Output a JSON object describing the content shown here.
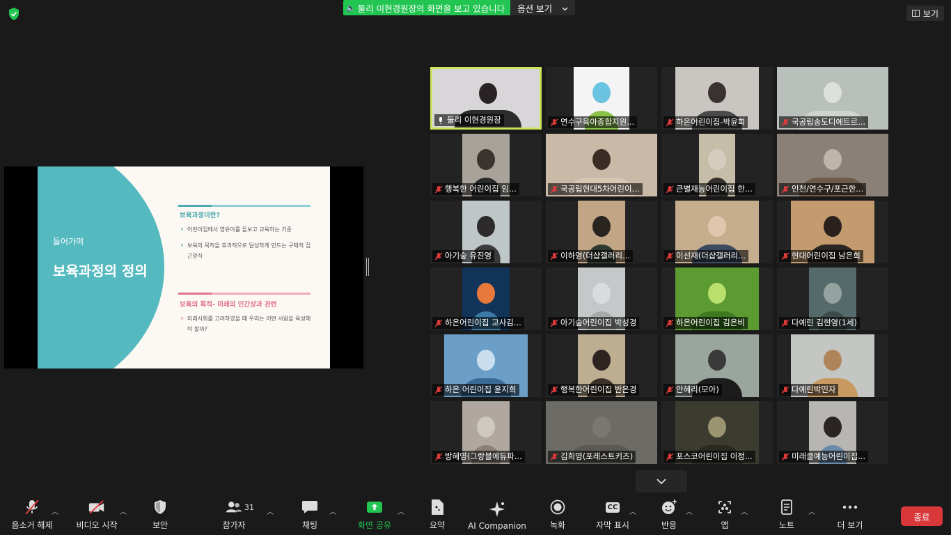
{
  "banner": {
    "text": "둘리 이현경원장의 화면을 보고 있습니다",
    "options": "옵션 보기"
  },
  "view_button": "보기",
  "slide": {
    "intro": "들어가며",
    "title": "보육과정의 정의",
    "section1_title": "보육과정이란?",
    "section1_bullets": [
      "어린이집에서 영유아를 돌보고 교육하는 기준",
      "보육의 목적을 효과적으로 달성하게 만드는 구체적 접근양식"
    ],
    "section2_title": "보육의 목적- 미래의 인간상과 관련",
    "section2_bullets": [
      "미래사회를 고려하였을 때 우리는 어떤 사람을 육성해야 할까?"
    ],
    "bullet_mark": "∨"
  },
  "participants": [
    {
      "name": "둘리 이현경원장",
      "active": true
    },
    {
      "name": "연수구육아종합지원..."
    },
    {
      "name": "하온어린이집-박윤희"
    },
    {
      "name": "국공립송도디에트르..."
    },
    {
      "name": "행복한 어린이집 임..."
    },
    {
      "name": "국공립현대5차어린이..."
    },
    {
      "name": "큰별재능어린이집 한..."
    },
    {
      "name": "인천/연수구/포근한..."
    },
    {
      "name": "아기숲 유진영"
    },
    {
      "name": "이하영(더샵갤러리..."
    },
    {
      "name": "이선재(더샵갤러리..."
    },
    {
      "name": "현대어린이집 남은희"
    },
    {
      "name": "하은어린이집 교사김..."
    },
    {
      "name": "아기숲어린이집 박성경"
    },
    {
      "name": "하은어린이집 김은비"
    },
    {
      "name": "다예린 김현영(1세)"
    },
    {
      "name": "하은 어린이집 윤지희"
    },
    {
      "name": "행복한어린이집 반은경"
    },
    {
      "name": "안혜리(모아)"
    },
    {
      "name": "다예린박민자"
    },
    {
      "name": "방혜영(그랑블에듀파..."
    },
    {
      "name": "김희영(포레스트키즈)"
    },
    {
      "name": "포스코어린이집 이정..."
    },
    {
      "name": "미래클예능어린이집..."
    }
  ],
  "toolbar": {
    "unmute": "음소거 해제",
    "start_video": "비디오 시작",
    "security": "보안",
    "participants": "참가자",
    "participants_count": "31",
    "chat": "채팅",
    "share_screen": "화면 공유",
    "summary": "요약",
    "ai_companion": "AI Companion",
    "record": "녹화",
    "captions": "자막 표시",
    "reactions": "반응",
    "apps": "앱",
    "notes": "노트",
    "more": "더 보기",
    "end": "종료",
    "cc_glyph": "CC"
  },
  "colors": {
    "share_green": "#23c552",
    "active_border": "#c9e55a",
    "end_red": "#d9383a",
    "slide_teal": "#55b9c0",
    "slide_pink": "#e0738f",
    "mute_red": "#e03b3b"
  }
}
